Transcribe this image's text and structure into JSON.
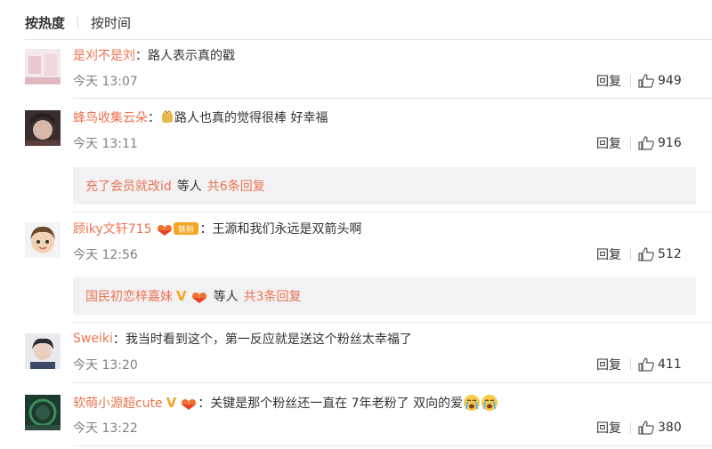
{
  "sort": {
    "hot_label": "按热度",
    "time_label": "按时间"
  },
  "icons": {
    "like": "thumb-up-icon",
    "verified": "v-badge-icon",
    "fan": "fan-badge-icon",
    "cry": "crying-emoji",
    "gold": "gold-hand-emoji"
  },
  "colors": {
    "username": "#eb7350",
    "meta": "#808080",
    "subbox_bg": "#f2f2f5",
    "vbadge": "#f5a623"
  },
  "comments": [
    {
      "username": "是刈不是刘",
      "colon": "：",
      "text": "路人表示真的戳",
      "time": "今天 13:07",
      "reply_label": "回复",
      "likes": "949"
    },
    {
      "username": "蜂鸟收集云朵",
      "colon": "：",
      "text": "路人也真的觉得很棒 好幸福",
      "time": "今天 13:11",
      "reply_label": "回复",
      "likes": "916",
      "sub": {
        "user": "充了会员就改id",
        "mid": "等人",
        "more": "共6条回复"
      }
    },
    {
      "username": "顾iky文轩715",
      "badge_text": "铁粉",
      "colon": "：",
      "text": "王源和我们永远是双箭头啊",
      "time": "今天 12:56",
      "reply_label": "回复",
      "likes": "512",
      "sub": {
        "user": "国民初恋梓嘉妹",
        "mid": "等人",
        "more": "共3条回复"
      }
    },
    {
      "username": "Sweiki",
      "colon": "：",
      "text": "我当时看到这个，第一反应就是送这个粉丝太幸福了",
      "time": "今天 13:20",
      "reply_label": "回复",
      "likes": "411"
    },
    {
      "username": "软萌小源超cute",
      "colon": "：",
      "text": "关键是那个粉丝还一直在 7年老粉了 双向的爱",
      "time": "今天 13:22",
      "reply_label": "回复",
      "likes": "380"
    }
  ]
}
